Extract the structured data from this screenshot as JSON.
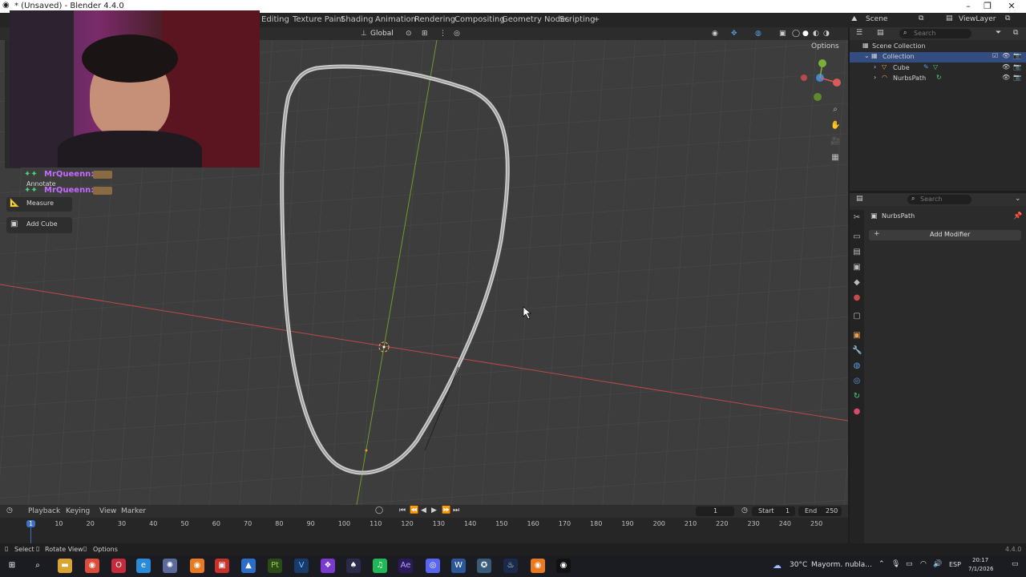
{
  "window": {
    "title": "* (Unsaved) - Blender 4.4.0"
  },
  "workspaces": [
    "Editing",
    "Texture Paint",
    "Shading",
    "Animation",
    "Rendering",
    "Compositing",
    "Geometry Nodes",
    "Scripting"
  ],
  "topbar_right": {
    "scene": "Scene",
    "view_layer": "ViewLayer"
  },
  "viewport_header": {
    "orientation": "Global",
    "options": "Options"
  },
  "tools": {
    "annotate": "Annotate",
    "measure": "Measure",
    "add_cube": "Add Cube"
  },
  "chat": [
    {
      "user": "MrQueenn:"
    },
    {
      "user": "MrQueenn:"
    }
  ],
  "outliner": {
    "search_placeholder": "Search",
    "scene_collection": "Scene Collection",
    "collection": "Collection",
    "items": [
      "Cube",
      "NurbsPath"
    ]
  },
  "properties": {
    "search_placeholder": "Search",
    "object_name": "NurbsPath",
    "add_modifier": "Add Modifier"
  },
  "timeline": {
    "menus": [
      "Playback",
      "Keying",
      "View",
      "Marker"
    ],
    "current_frame": "1",
    "start_label": "Start",
    "start": "1",
    "end_label": "End",
    "end": "250",
    "ruler": [
      "1",
      "10",
      "20",
      "30",
      "40",
      "50",
      "60",
      "70",
      "80",
      "90",
      "100",
      "110",
      "120",
      "130",
      "140",
      "150",
      "160",
      "170",
      "180",
      "190",
      "200",
      "210",
      "220",
      "230",
      "240",
      "250"
    ]
  },
  "statusbar": {
    "select": "Select",
    "rotate_view": "Rotate View",
    "options": "Options",
    "version": "4.4.0"
  },
  "taskbar": {
    "weather_temp": "30°C",
    "weather_desc": "Mayorm. nubla...",
    "lang": "ESP",
    "time": "20:17",
    "date": "7/1/2026"
  },
  "colors": {
    "x_axis": "#b84a4a",
    "y_axis": "#6e9a2a",
    "curve": "#c9c9c9",
    "viewport_bg": "#3d3d3d",
    "chat_name": "#c36bff"
  }
}
